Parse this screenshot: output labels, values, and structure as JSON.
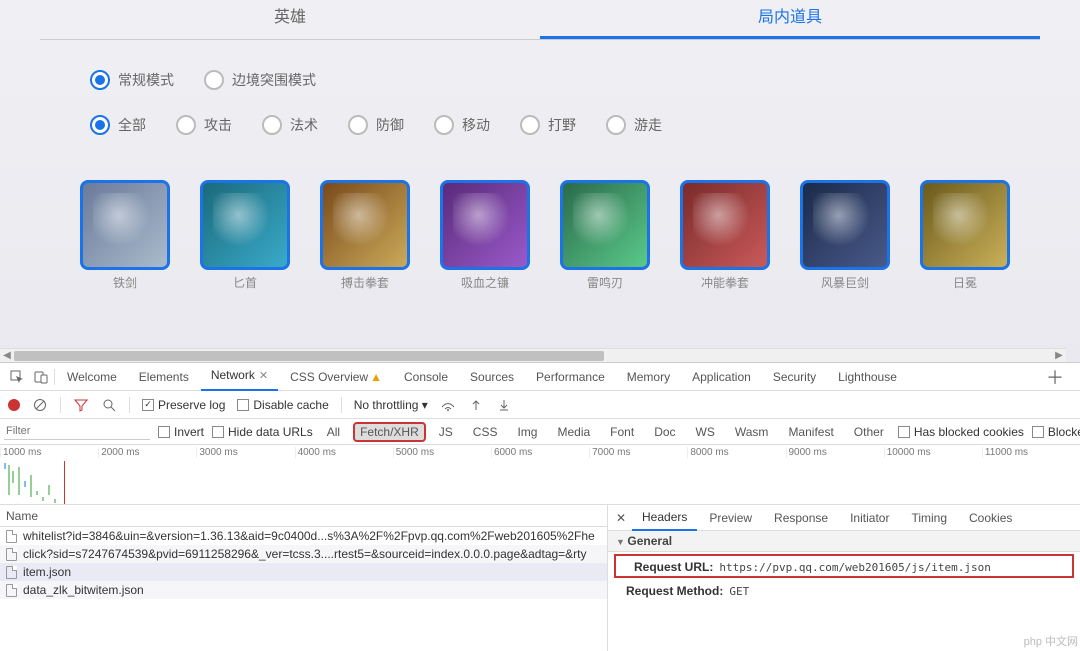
{
  "web": {
    "tabs": [
      {
        "label": "英雄",
        "active": false
      },
      {
        "label": "局内道具",
        "active": true
      }
    ],
    "modes": [
      {
        "label": "常规模式",
        "checked": true
      },
      {
        "label": "边境突围模式",
        "checked": false
      }
    ],
    "filters": [
      {
        "label": "全部",
        "checked": true
      },
      {
        "label": "攻击",
        "checked": false
      },
      {
        "label": "法术",
        "checked": false
      },
      {
        "label": "防御",
        "checked": false
      },
      {
        "label": "移动",
        "checked": false
      },
      {
        "label": "打野",
        "checked": false
      },
      {
        "label": "游走",
        "checked": false
      }
    ],
    "items": [
      {
        "name": "铁剑",
        "cls": "silver"
      },
      {
        "name": "匕首",
        "cls": "teal"
      },
      {
        "name": "搏击拳套",
        "cls": "orange"
      },
      {
        "name": "吸血之镰",
        "cls": "purple"
      },
      {
        "name": "雷鸣刃",
        "cls": "jade"
      },
      {
        "name": "冲能拳套",
        "cls": "red"
      },
      {
        "name": "风暴巨剑",
        "cls": "night"
      },
      {
        "name": "日冕",
        "cls": "gold"
      }
    ]
  },
  "dev": {
    "tabs": [
      "Welcome",
      "Elements",
      "Network",
      "CSS Overview",
      "Console",
      "Sources",
      "Performance",
      "Memory",
      "Application",
      "Security",
      "Lighthouse"
    ],
    "active_tab": "Network",
    "css_overview_warn": "▲",
    "toolbar": {
      "preserve_log": "Preserve log",
      "disable_cache": "Disable cache",
      "throttling": "No throttling"
    },
    "filterbar": {
      "filter_placeholder": "Filter",
      "invert": "Invert",
      "hide_data_urls": "Hide data URLs",
      "types": [
        "All",
        "Fetch/XHR",
        "JS",
        "CSS",
        "Img",
        "Media",
        "Font",
        "Doc",
        "WS",
        "Wasm",
        "Manifest",
        "Other"
      ],
      "active_type": "Fetch/XHR",
      "has_blocked_cookies": "Has blocked cookies",
      "blocked_requests": "Blocked Requests"
    },
    "timeline_labels": [
      "1000 ms",
      "2000 ms",
      "3000 ms",
      "4000 ms",
      "5000 ms",
      "6000 ms",
      "7000 ms",
      "8000 ms",
      "9000 ms",
      "10000 ms",
      "11000 ms"
    ],
    "requests": {
      "header": "Name",
      "rows": [
        "whitelist?id=3846&uin=&version=1.36.13&aid=9c0400d...s%3A%2F%2Fpvp.qq.com%2Fweb201605%2Fhe",
        "click?sid=s7247674539&pvid=6911258296&_ver=tcss.3....rtest5=&sourceid=index.0.0.0.page&adtag=&rty",
        "item.json",
        "data_zlk_bitwitem.json"
      ],
      "selected": 2
    },
    "detail": {
      "tabs": [
        "Headers",
        "Preview",
        "Response",
        "Initiator",
        "Timing",
        "Cookies"
      ],
      "active": "Headers",
      "section": "General",
      "request_url_label": "Request URL:",
      "request_url": "https://pvp.qq.com/web201605/js/item.json",
      "request_method_label": "Request Method:",
      "request_method": "GET"
    }
  },
  "watermark": "php 中文网"
}
